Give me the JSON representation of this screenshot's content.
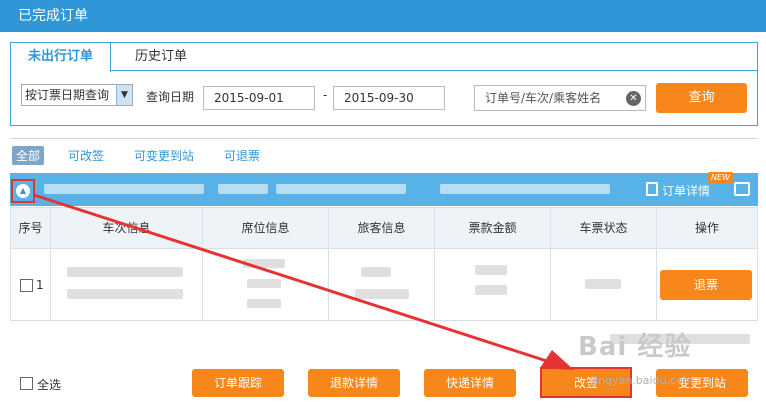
{
  "window": {
    "title": "已完成订单"
  },
  "tabs": [
    {
      "label": "未出行订单",
      "active": true
    },
    {
      "label": "历史订单",
      "active": false
    }
  ],
  "search": {
    "mode_selected": "按订票日期查询",
    "date_label": "查询日期",
    "date_from": "2015-09-01",
    "date_separator": "-",
    "date_to": "2015-09-30",
    "keyword_placeholder": "订单号/车次/乘客姓名",
    "query_button": "查询"
  },
  "filters": [
    "全部",
    "可改签",
    "可变更到站",
    "可退票"
  ],
  "order_header": {
    "detail_label": "订单详情",
    "new_badge": "NEW"
  },
  "table": {
    "columns": [
      "序号",
      "车次信息",
      "席位信息",
      "旅客信息",
      "票款金额",
      "车票状态",
      "操作"
    ],
    "rows": [
      {
        "index": "1",
        "action": "退票"
      }
    ]
  },
  "footer": {
    "select_all": "全选",
    "buttons": [
      "订单跟踪",
      "退款详情",
      "快递详情",
      "改签",
      "变更到站"
    ]
  },
  "watermark": {
    "brand": "Bai 经验",
    "url": "jingyan.baidu.com"
  },
  "colors": {
    "accent": "#2f97d8",
    "action": "#f7861b",
    "highlight": "#e53333"
  }
}
